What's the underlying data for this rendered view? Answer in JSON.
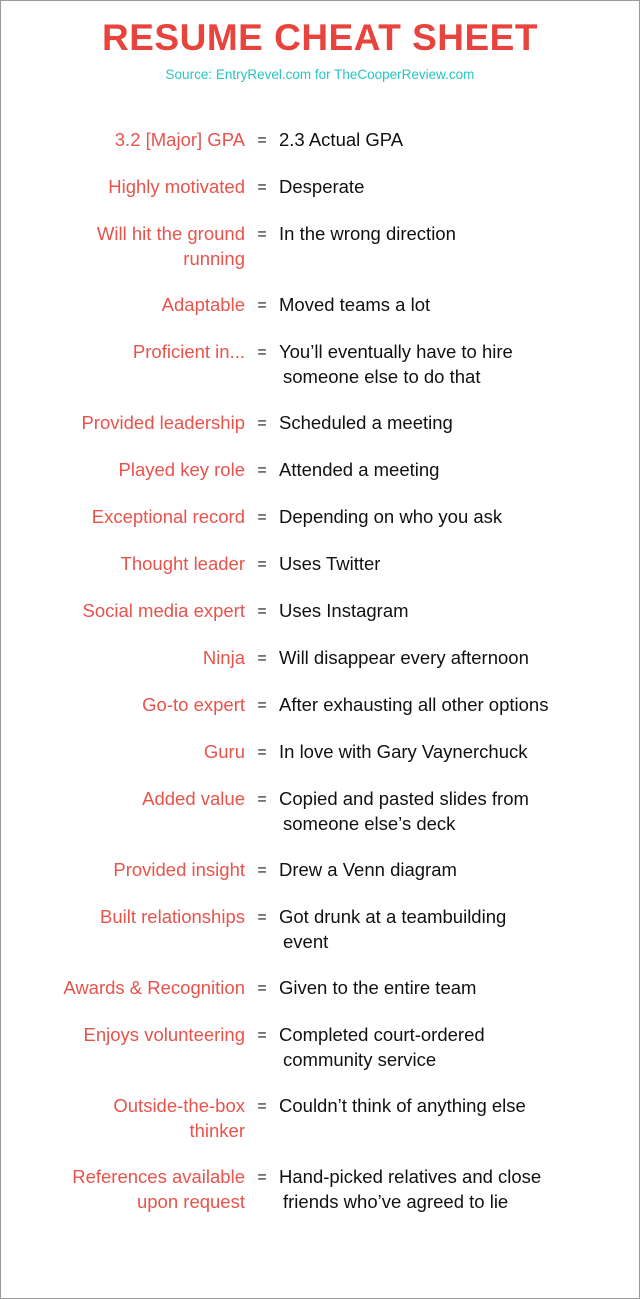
{
  "header": {
    "title": "RESUME CHEAT SHEET",
    "source": "Source:  EntryRevel.com for TheCooperReview.com",
    "title_color": "#e8433c",
    "source_color": "#2ac3c3"
  },
  "equals_symbol": "=",
  "colors": {
    "term_red": "#e8534b",
    "meaning_black": "#111111",
    "background": "#ffffff",
    "border": "#9a9a9a"
  },
  "rows": [
    {
      "term": "3.2 [Major] GPA",
      "meaning": "2.3 Actual GPA"
    },
    {
      "term": "Highly motivated",
      "meaning": "Desperate"
    },
    {
      "term": "Will hit the ground\nrunning",
      "meaning": "In the wrong direction"
    },
    {
      "term": "Adaptable",
      "meaning": "Moved teams a lot"
    },
    {
      "term": "Proficient in...",
      "meaning": "You’ll eventually have to hire",
      "meaning_line2": "someone else to do that"
    },
    {
      "term": "Provided leadership",
      "meaning": "Scheduled a meeting"
    },
    {
      "term": "Played key role",
      "meaning": "Attended a meeting"
    },
    {
      "term": "Exceptional record",
      "meaning": "Depending on who you ask"
    },
    {
      "term": "Thought leader",
      "meaning": "Uses Twitter"
    },
    {
      "term": "Social media expert",
      "meaning": "Uses Instagram"
    },
    {
      "term": "Ninja",
      "meaning": "Will disappear every afternoon"
    },
    {
      "term": "Go-to expert",
      "meaning": "After exhausting all other options"
    },
    {
      "term": "Guru",
      "meaning": "In love with Gary Vaynerchuck"
    },
    {
      "term": "Added value",
      "meaning": "Copied and pasted slides from",
      "meaning_line2": "someone else’s deck"
    },
    {
      "term": "Provided insight",
      "meaning": "Drew a Venn diagram"
    },
    {
      "term": "Built relationships",
      "meaning": "Got drunk at a teambuilding",
      "meaning_line2": "event"
    },
    {
      "term": "Awards & Recognition",
      "meaning": "Given to the entire team"
    },
    {
      "term": "Enjoys volunteering",
      "meaning": "Completed court-ordered",
      "meaning_line2": "community service"
    },
    {
      "term": "Outside-the-box\nthinker",
      "meaning": "Couldn’t think of anything else"
    },
    {
      "term": "References available\nupon request",
      "meaning": "Hand-picked relatives and close",
      "meaning_line2": "friends who’ve agreed to lie"
    }
  ]
}
